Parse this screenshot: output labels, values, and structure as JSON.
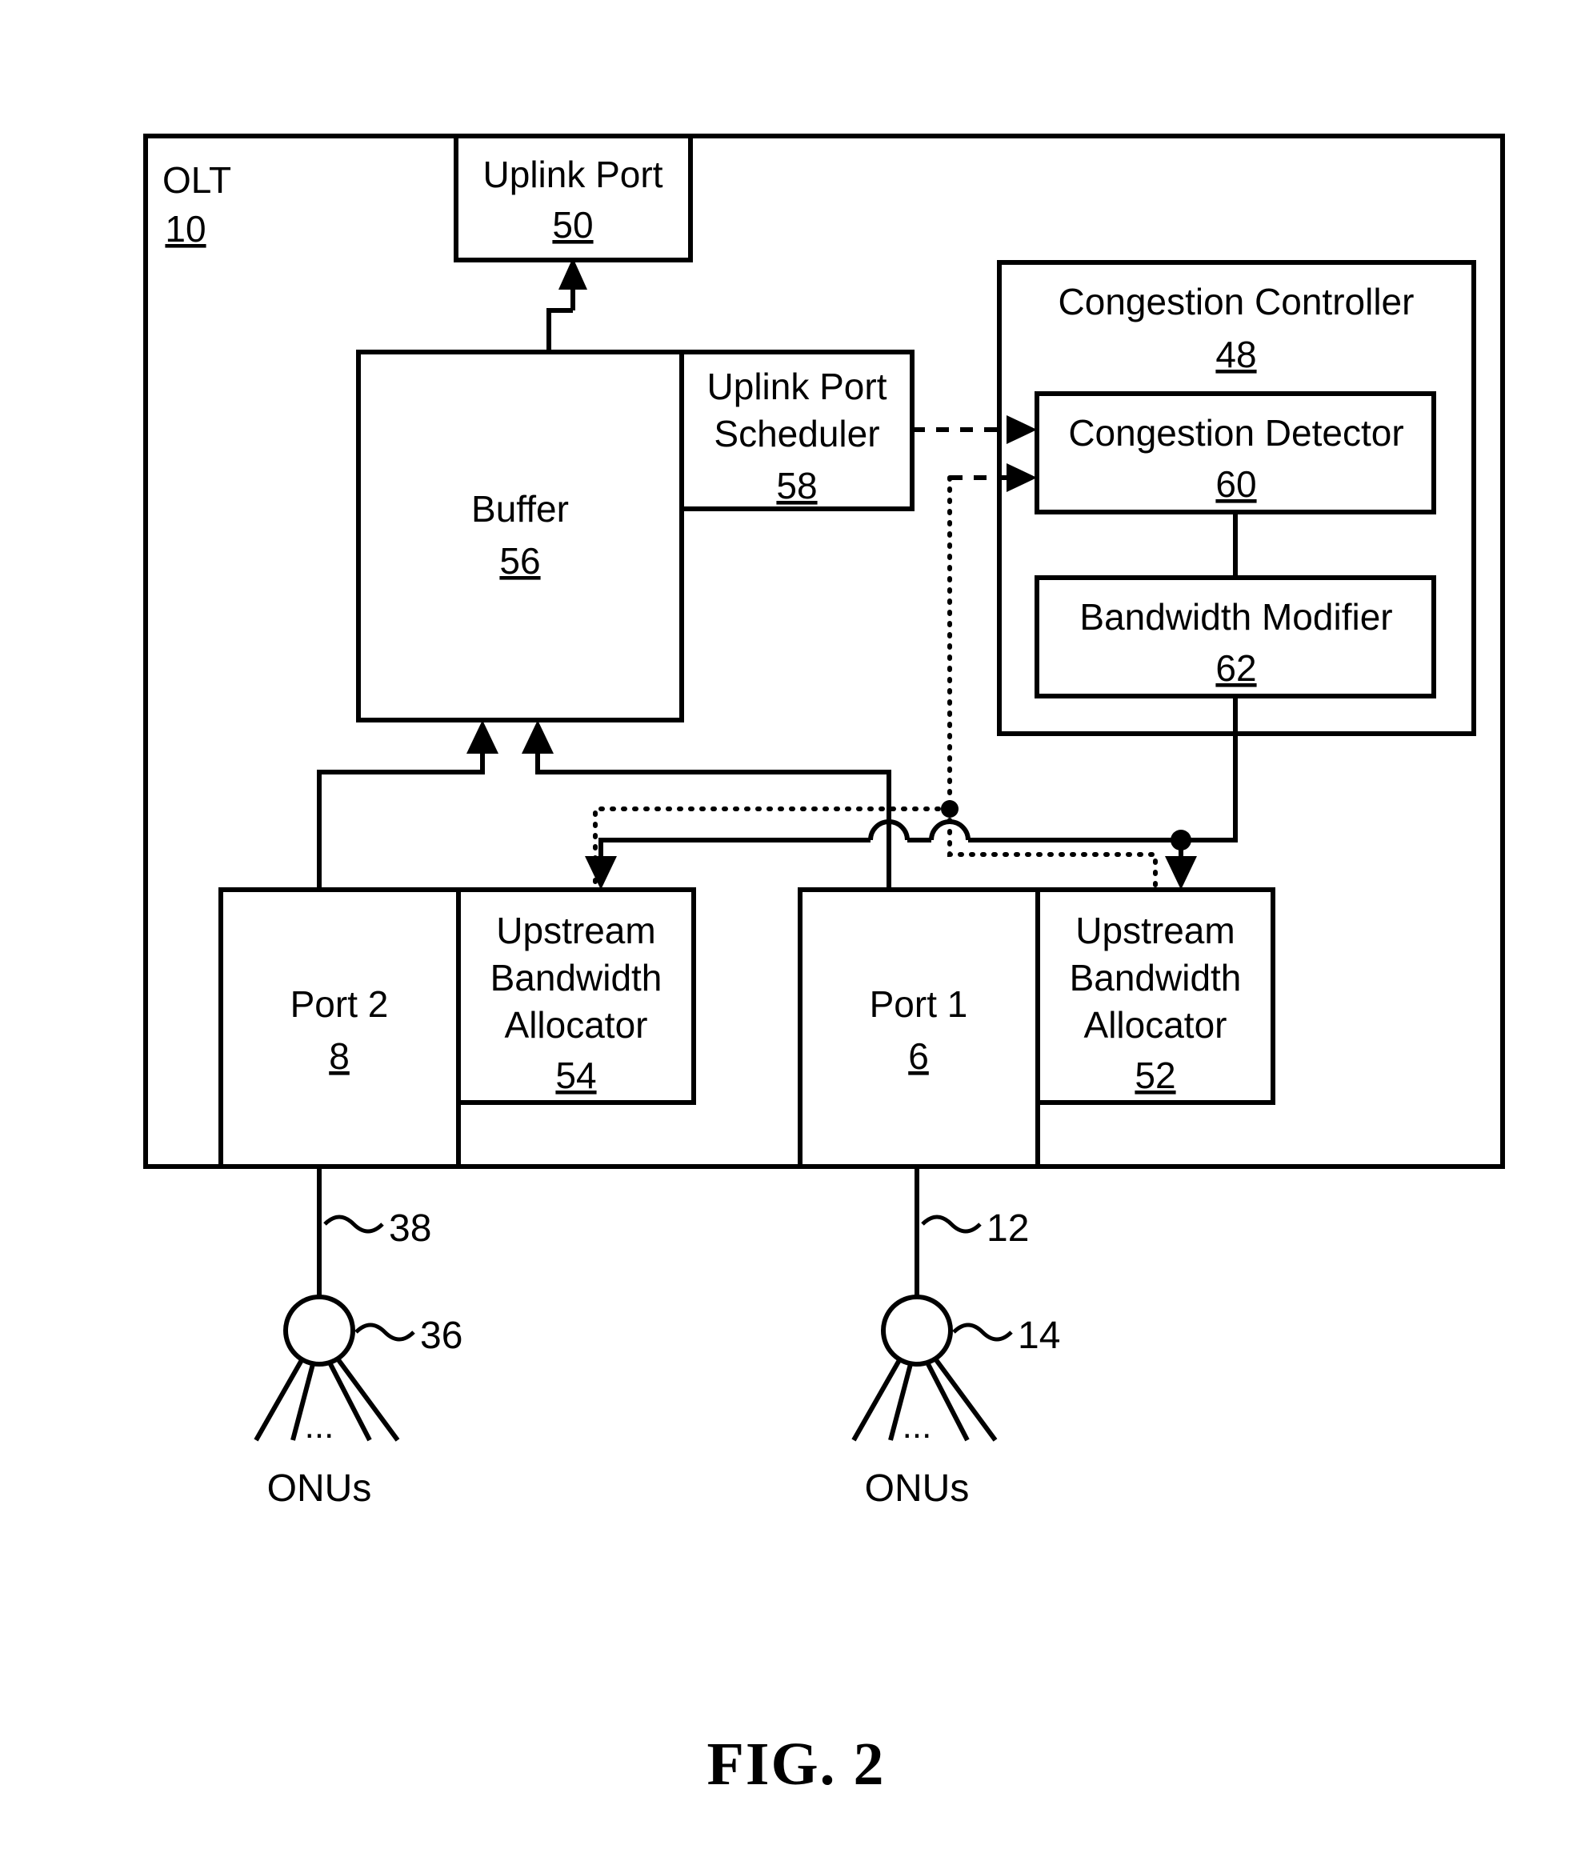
{
  "figure": {
    "caption": "FIG. 2",
    "outer_label": "OLT",
    "outer_ref": "10"
  },
  "blocks": {
    "uplink_port": {
      "title": "Uplink Port",
      "ref": "50"
    },
    "uplink_port_scheduler": {
      "line1": "Uplink Port",
      "line2": "Scheduler",
      "ref": "58"
    },
    "buffer": {
      "title": "Buffer",
      "ref": "56"
    },
    "congestion_controller": {
      "title": "Congestion Controller",
      "ref": "48"
    },
    "congestion_detector": {
      "title": "Congestion Detector",
      "ref": "60"
    },
    "bandwidth_modifier": {
      "title": "Bandwidth Modifier",
      "ref": "62"
    },
    "port2": {
      "title": "Port 2",
      "ref": "8"
    },
    "port1": {
      "title": "Port 1",
      "ref": "6"
    },
    "upstream_bw_alloc_54": {
      "line1": "Upstream",
      "line2": "Bandwidth",
      "line3": "Allocator",
      "ref": "54"
    },
    "upstream_bw_alloc_52": {
      "line1": "Upstream",
      "line2": "Bandwidth",
      "line3": "Allocator",
      "ref": "52"
    }
  },
  "network": {
    "left_fiber_ref": "38",
    "left_splitter_ref": "36",
    "left_onus_label": "ONUs",
    "left_onus_ellipsis": "...",
    "right_fiber_ref": "12",
    "right_splitter_ref": "14",
    "right_onus_label": "ONUs",
    "right_onus_ellipsis": "..."
  },
  "colors": {
    "ink": "#000000",
    "paper": "#ffffff"
  }
}
